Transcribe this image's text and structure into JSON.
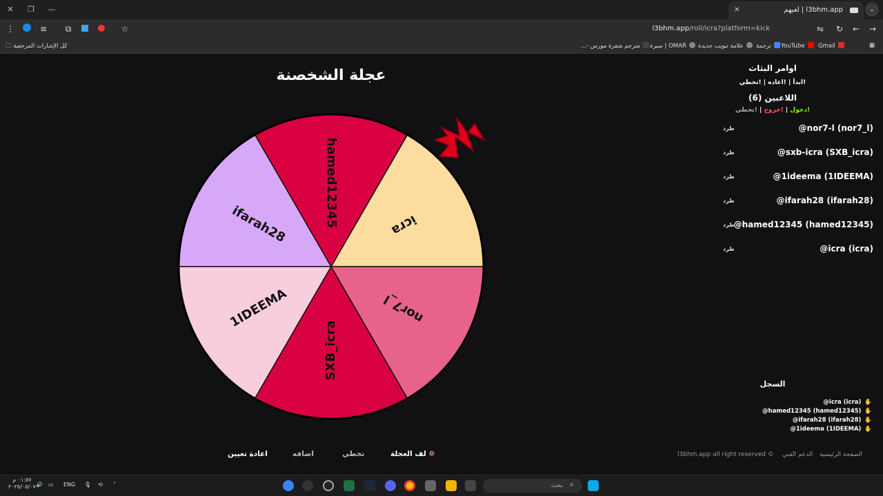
{
  "browser": {
    "tab_title": "l3bhm.app | لعبهم",
    "url_host": "l3bhm.app",
    "url_path": "/roll/icra?platform=kick",
    "bookmarks": [
      {
        "label": "Gmail",
        "color": "#d93025"
      },
      {
        "label": "YouTube",
        "color": "#ff0000"
      },
      {
        "label": "ترجمة",
        "color": "#4285f4"
      },
      {
        "label": "علامة تبويب جديدة",
        "color": "#888888"
      },
      {
        "label": "OMAR | سيرة",
        "color": "#888888"
      },
      {
        "label": "مترجم شفرة مورس -...",
        "color": "#444444"
      }
    ],
    "all_bookmarks": "كل الإشارات المرجعية"
  },
  "wheel": {
    "title": "عجلة الشخصنة",
    "segments": [
      {
        "label": "icra",
        "color": "#fcdc9f"
      },
      {
        "label": "hamed12345",
        "color": "#d90042"
      },
      {
        "label": "ifarah28",
        "color": "#d8a8f8"
      },
      {
        "label": "1IDEEMA",
        "color": "#f8cede"
      },
      {
        "label": "SXB_icra",
        "color": "#d90042"
      },
      {
        "label": "nor7_l",
        "color": "#e8638c"
      }
    ]
  },
  "commands": {
    "title": "اوامر البثاث",
    "line": "!ابدأ | !اعاده | !تخطي"
  },
  "players": {
    "title": "اللاعبين (6)",
    "join": "!دخول",
    "leave": "!خروج",
    "skip": "!تخطي",
    "kick_label": "طرد",
    "list": [
      "@nor7-l (nor7_l)",
      "@sxb-icra (SXB_icra)",
      "@1ideema (1IDEEMA)",
      "@ifarah28 (ifarah28)",
      "@hamed12345 (hamed12345)",
      "@icra (icra)"
    ]
  },
  "log": {
    "title": "السجل",
    "items": [
      "@icra (icra)",
      "@hamed12345 (hamed12345)",
      "@ifarah28 (ifarah28)",
      "@1ideema (1IDEEMA)"
    ]
  },
  "actions": {
    "spin": "لف العجلة",
    "skip": "تخطي",
    "add": "اضافه",
    "reset": "اعادة تعيين"
  },
  "footer": {
    "copyright": "l3bhm.app all right reserved ©",
    "support": "الدعم الفني",
    "home": "الصفحة الرئيسية"
  },
  "taskbar": {
    "search_placeholder": "بحث",
    "lang": "ENG",
    "time": "٠١:٥٧ م",
    "date": "٢٠٢٥/٠٥/٠٧"
  }
}
